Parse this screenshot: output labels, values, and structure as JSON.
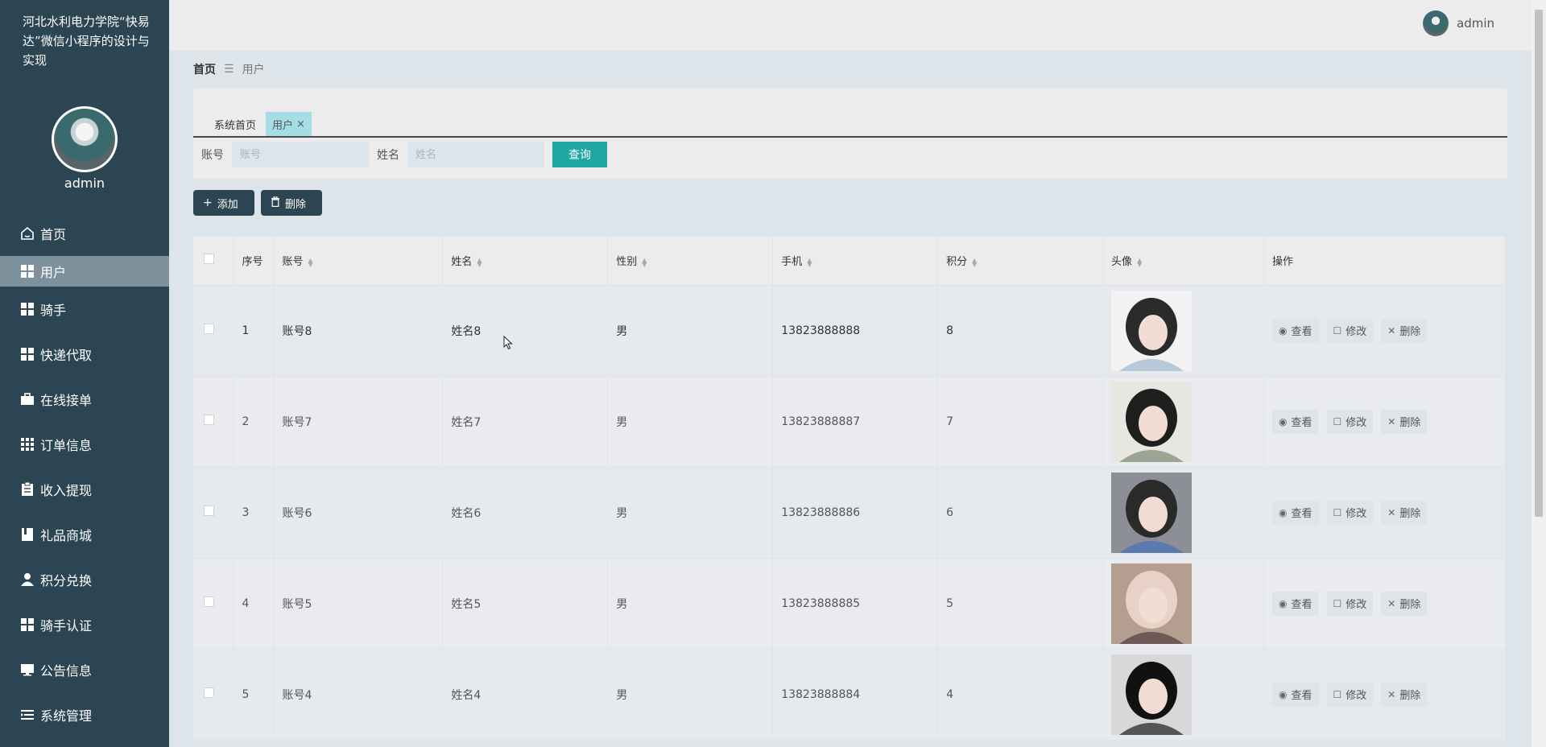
{
  "app": {
    "title": "河北水利电力学院“快易达”微信小程序的设计与实现",
    "username": "admin"
  },
  "sidebar": {
    "items": [
      {
        "label": "首页",
        "icon": "home-icon"
      },
      {
        "label": "用户",
        "icon": "grid-icon",
        "active": true
      },
      {
        "label": "骑手",
        "icon": "grid-icon"
      },
      {
        "label": "快递代取",
        "icon": "grid-icon"
      },
      {
        "label": "在线接单",
        "icon": "briefcase-icon"
      },
      {
        "label": "订单信息",
        "icon": "grid9-icon"
      },
      {
        "label": "收入提现",
        "icon": "clipboard-icon"
      },
      {
        "label": "礼品商城",
        "icon": "book-icon"
      },
      {
        "label": "积分兑换",
        "icon": "user-icon"
      },
      {
        "label": "骑手认证",
        "icon": "grid-icon"
      },
      {
        "label": "公告信息",
        "icon": "monitor-icon"
      },
      {
        "label": "系统管理",
        "icon": "list-icon"
      }
    ]
  },
  "breadcrumb": {
    "home": "首页",
    "current": "用户"
  },
  "tabs": [
    {
      "label": "系统首页"
    },
    {
      "label": "用户",
      "close": "×"
    }
  ],
  "search": {
    "account_label": "账号",
    "account_placeholder": "账号",
    "name_label": "姓名",
    "name_placeholder": "姓名",
    "query_label": "查询"
  },
  "actions": {
    "add_label": "添加",
    "delete_label": "删除"
  },
  "table": {
    "columns": [
      "序号",
      "账号",
      "姓名",
      "性别",
      "手机",
      "积分",
      "头像",
      "操作"
    ],
    "ops": {
      "view": "查看",
      "edit": "修改",
      "delete": "删除"
    },
    "rows": [
      {
        "no": "1",
        "account": "账号8",
        "name": "姓名8",
        "gender": "男",
        "phone": "13823888888",
        "points": "8",
        "photo_colors": [
          "#f2f2f2",
          "#2a2a2a",
          "#b8c8d8"
        ]
      },
      {
        "no": "2",
        "account": "账号7",
        "name": "姓名7",
        "gender": "男",
        "phone": "13823888887",
        "points": "7",
        "photo_colors": [
          "#e8e6e0",
          "#1e1e1e",
          "#9aa594"
        ]
      },
      {
        "no": "3",
        "account": "账号6",
        "name": "姓名6",
        "gender": "男",
        "phone": "13823888886",
        "points": "6",
        "photo_colors": [
          "#8c8f95",
          "#2a2a2a",
          "#5b7bb0"
        ]
      },
      {
        "no": "4",
        "account": "账号5",
        "name": "姓名5",
        "gender": "男",
        "phone": "13823888885",
        "points": "5",
        "photo_colors": [
          "#b39e90",
          "#e8d2c8",
          "#6b5a55"
        ]
      },
      {
        "no": "5",
        "account": "账号4",
        "name": "姓名4",
        "gender": "男",
        "phone": "13823888884",
        "points": "4",
        "photo_colors": [
          "#d8d8d8",
          "#111111",
          "#555555"
        ]
      }
    ]
  },
  "colors": {
    "sidebar_bg": "#2b4552",
    "accent": "#1fa6a0",
    "active_tab": "#a4dee4",
    "active_menu": "#7c919b"
  }
}
